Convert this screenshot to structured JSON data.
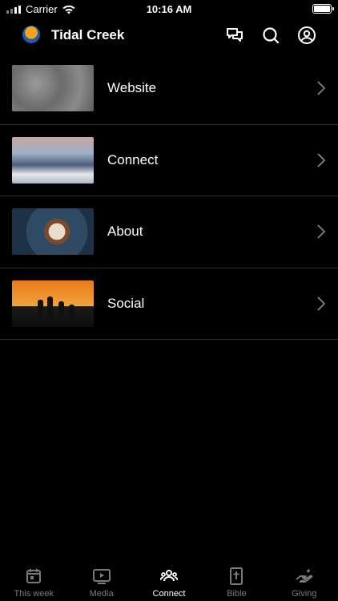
{
  "status": {
    "carrier": "Carrier",
    "time": "10:16 AM"
  },
  "header": {
    "title": "Tidal Creek"
  },
  "items": [
    {
      "label": "Website"
    },
    {
      "label": "Connect"
    },
    {
      "label": "About"
    },
    {
      "label": "Social"
    }
  ],
  "tabs": [
    {
      "label": "This week",
      "icon": "calendar-icon",
      "active": false
    },
    {
      "label": "Media",
      "icon": "play-icon",
      "active": false
    },
    {
      "label": "Connect",
      "icon": "people-icon",
      "active": true
    },
    {
      "label": "Bible",
      "icon": "bible-icon",
      "active": false
    },
    {
      "label": "Giving",
      "icon": "hand-icon",
      "active": false
    }
  ],
  "colors": {
    "background": "#000000",
    "active_tab": "#ffffff",
    "inactive_tab": "#7a7a7a"
  }
}
